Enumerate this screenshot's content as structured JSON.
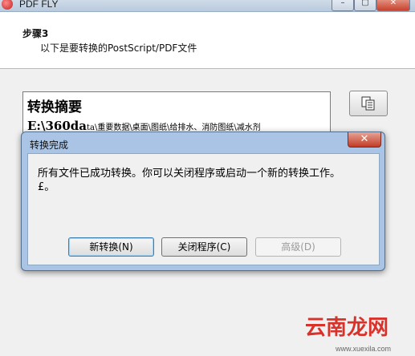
{
  "main_window": {
    "title": "PDF FLY",
    "controls": [
      "–",
      "▢",
      "✕"
    ]
  },
  "step": {
    "title": "步骤3",
    "description": "以下是要转换的PostScript/PDF文件"
  },
  "summary": {
    "title": "转换摘要",
    "path_main": "E:\\360da",
    "path_small": "ta\\重要数据\\桌面\\图纸\\给排水、消防图纸\\减水剂"
  },
  "dialog": {
    "title": "转换完成",
    "close_glyph": "✕",
    "message": "所有文件已成功转换。你可以关闭程序或启动一个新的转换工作。",
    "message_extra": "£。",
    "buttons": {
      "new_conversion": "新转换(N)",
      "close_program": "关闭程序(C)",
      "advanced": "高级(D)"
    }
  },
  "watermark": {
    "text": "云南龙网",
    "url": "www.xuexila.com"
  }
}
